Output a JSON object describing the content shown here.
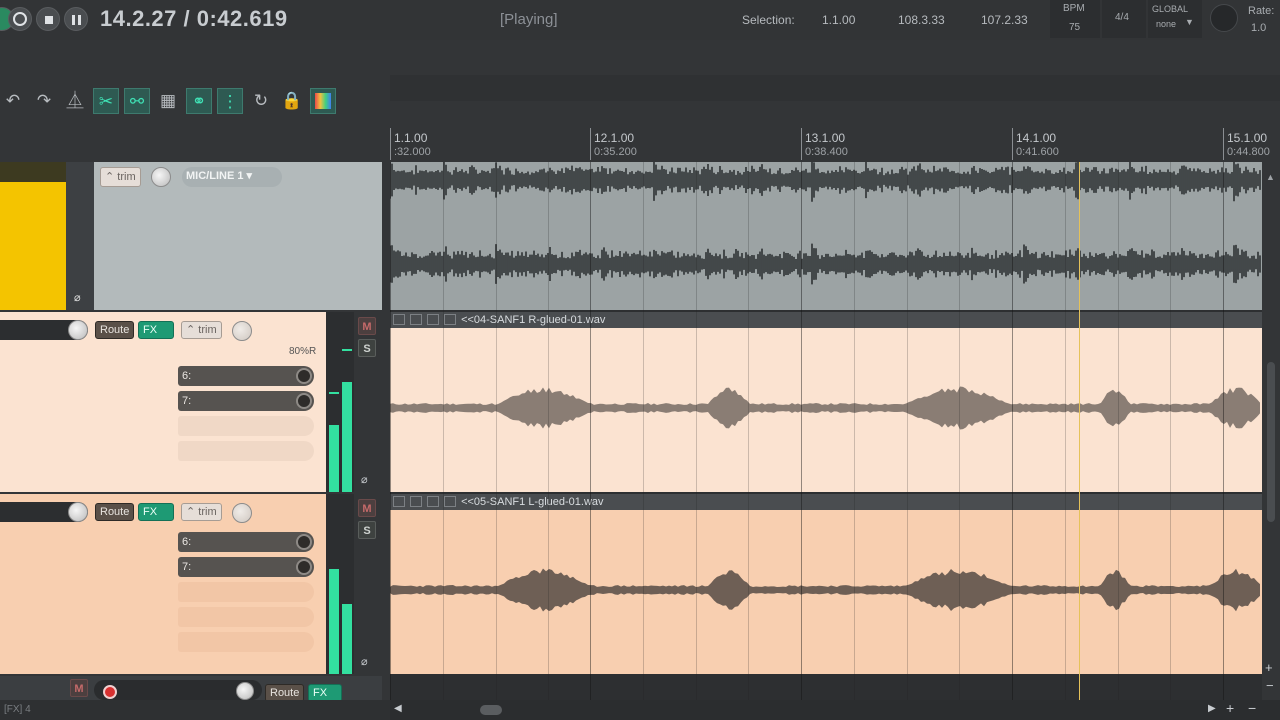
{
  "transport": {
    "time": "14.2.27 / 0:42.619",
    "state": "[Playing]",
    "selection_label": "Selection:",
    "sel_start": "1.1.00",
    "sel_end": "108.3.33",
    "sel_length": "107.2.33",
    "bpm_label": "BPM",
    "bpm": "75",
    "time_sig": "4/4",
    "global_label": "GLOBAL",
    "global_value": "none",
    "rate_label": "Rate:",
    "rate": "1.0"
  },
  "ruler": {
    "marks": [
      {
        "bar": "1.1.00",
        "time": ":32.000"
      },
      {
        "bar": "12.1.00",
        "time": "0:35.200"
      },
      {
        "bar": "13.1.00",
        "time": "0:38.400"
      },
      {
        "bar": "14.1.00",
        "time": "0:41.600"
      },
      {
        "bar": "15.1.00",
        "time": "0:44.800"
      }
    ]
  },
  "tracks": {
    "t1": {
      "trim": "trim",
      "input": "MIC/LINE 1"
    },
    "t2": {
      "route": "Route",
      "fx": "FX",
      "trim": "trim",
      "pan": "80%R",
      "send1": "6:",
      "send2": "7:",
      "mute": "M",
      "solo": "S"
    },
    "t3": {
      "route": "Route",
      "fx": "FX",
      "trim": "trim",
      "send1": "6:",
      "send2": "7:",
      "mute": "M",
      "solo": "S"
    },
    "t4": {
      "mute": "M",
      "route": "Route",
      "fx": "FX"
    }
  },
  "items": {
    "item2": "<<04-SANF1 R-glued-01.wav",
    "item3": "<<05-SANF1 L-glued-01.wav"
  },
  "status": "[FX] 4",
  "colors": {
    "track1": "#b3babb",
    "track2": "#fbe3d1",
    "track3": "#f8cfb0",
    "accent": "#33e0a0",
    "playhead": "#e5c25a"
  }
}
